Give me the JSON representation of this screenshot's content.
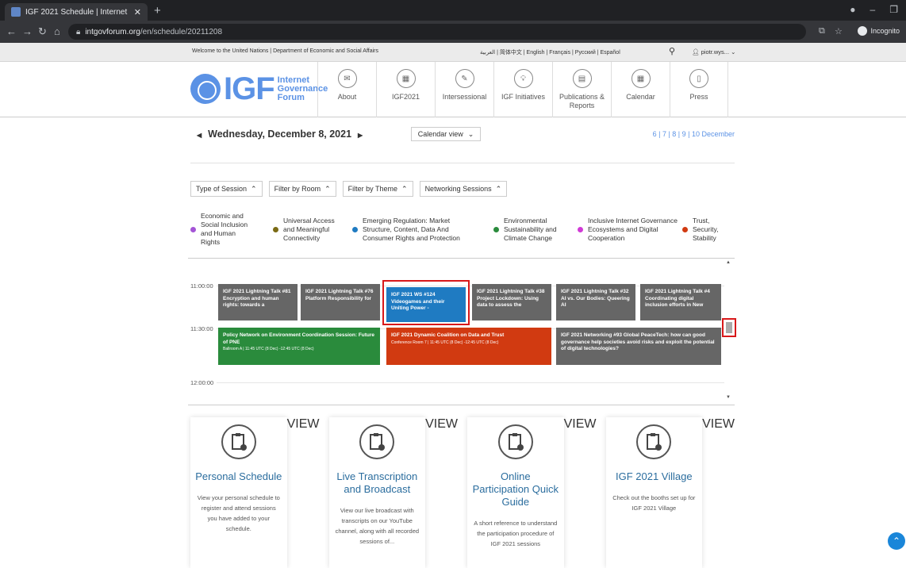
{
  "browser": {
    "tab_title": "IGF 2021 Schedule | Internet Gov",
    "url_host": "intgovforum.org",
    "url_path": "/en/schedule/20211208",
    "incognito_label": "Incognito"
  },
  "unbar": {
    "left": "Welcome to the United Nations  |  Department of Economic and Social Affairs",
    "languages": "العربية | 简体中文 | English | Français | Русский | Español",
    "user": "piotr.wys..."
  },
  "logo": {
    "big": "IGF",
    "line1": "Internet",
    "line2": "Governance",
    "line3": "Forum"
  },
  "nav": [
    "About",
    "IGF2021",
    "Intersessional",
    "IGF Initiatives",
    "Publications & Reports",
    "Calendar",
    "Press"
  ],
  "schedule": {
    "date": "Wednesday, December 8, 2021",
    "calendar_view": "Calendar view",
    "day_links": "6 | 7 | 8 | 9 | 10 December"
  },
  "filters": [
    "Type of Session",
    "Filter by Room",
    "Filter by Theme",
    "Networking Sessions"
  ],
  "themes": [
    {
      "label": "Economic and Social Inclusion and Human Rights",
      "color": "#a455d6"
    },
    {
      "label": "Universal Access and Meaningful Connectivity",
      "color": "#7a6a14"
    },
    {
      "label": "Emerging Regulation: Market Structure, Content, Data And Consumer Rights and Protection",
      "color": "#1f7bc2"
    },
    {
      "label": "Environmental Sustainability and Climate Change",
      "color": "#2a8b3c"
    },
    {
      "label": "Inclusive Internet Governance Ecosystems and Digital Cooperation",
      "color": "#d13ad6"
    },
    {
      "label": "Trust, Security, Stability",
      "color": "#d13a11"
    }
  ],
  "times": [
    "11:00:00",
    "11:30:00",
    "12:00:00"
  ],
  "sessions": [
    {
      "text": "IGF 2021 Lightning Talk #81 Encryption and human rights: towards a"
    },
    {
      "text": "IGF 2021 Lightning Talk #76 Platform Responsibility for"
    },
    {
      "text": "IGF 2021 WS #124 Videogames and their Uniting Power -"
    },
    {
      "text": "IGF 2021 Lightning Talk #38 Project Lockdown: Using data to assess the"
    },
    {
      "text": "IGF 2021 Lightning Talk #32 AI vs. Our Bodies: Queering AI"
    },
    {
      "text": "IGF 2021 Lightning Talk #4 Coordinating digital inclusion efforts in New"
    }
  ],
  "sessions2": [
    {
      "text": "Policy Network on Environment Coordination Session: Future of PNE",
      "sub": "Ballroom A | 11:45 UTC (8 Dec) -12:45 UTC (8 Dec)"
    },
    {
      "text": "IGF 2021 Dynamic Coalition on Data and Trust",
      "sub": "Conference Room 7 | 11:45 UTC (8 Dec) -12:45 UTC (8 Dec)"
    },
    {
      "text": "IGF 2021 Networking #93 Global PeaceTech: how can good governance help societies avoid risks and exploit the potential of digital technologies?",
      "sub": ""
    }
  ],
  "cards": [
    {
      "title": "Personal Schedule",
      "desc": "View your personal schedule to register and attend sessions you have added to your schedule.",
      "button": "VIEW"
    },
    {
      "title": "Live Transcription and Broadcast",
      "desc": "View our live broadcast with transcripts on our YouTube channel, along with all recorded sessions of...",
      "button": "VIEW"
    },
    {
      "title": "Online Participation Quick Guide",
      "desc": "A short reference to understand the participation procedure of IGF 2021 sessions",
      "button": "VIEW"
    },
    {
      "title": "IGF 2021 Village",
      "desc": "Check out the booths set up for IGF 2021 Village",
      "button": "VIEW"
    }
  ]
}
